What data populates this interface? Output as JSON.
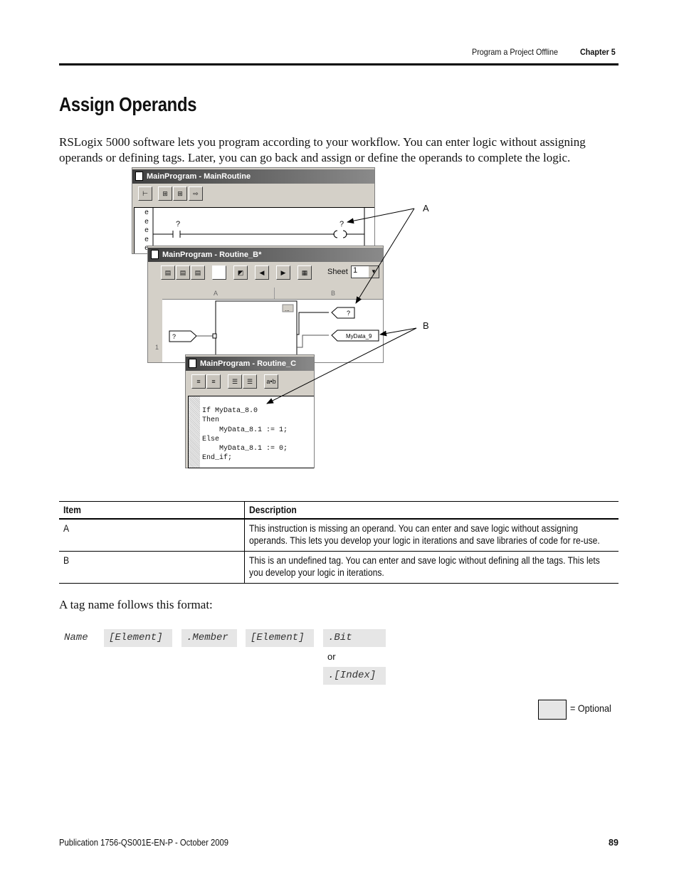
{
  "header": {
    "section": "Program a Project Offline",
    "chapter": "Chapter 5"
  },
  "title": "Assign Operands",
  "intro": "RSLogix 5000 software lets you program according to your workflow. You can enter logic without assigning operands or defining tags. Later, you can go back and assign or define the operands to complete the logic.",
  "figure": {
    "window1": {
      "title": "MainProgram - MainRoutine",
      "rung_markers": [
        "e",
        "e",
        "e",
        "e",
        "e"
      ],
      "contact_operand": "?",
      "coil_operand": "?"
    },
    "window2": {
      "title": "MainProgram - Routine_B*",
      "sheet_label": "Sheet",
      "sheet_value": "1",
      "columns": [
        "A",
        "B"
      ],
      "row": "1",
      "input_ref": "?",
      "output_ref1": "?",
      "output_ref2": "MyData_9",
      "block_button": "..."
    },
    "window3": {
      "title": "MainProgram - Routine_C",
      "format_button": "a•b",
      "code": [
        "If MyData_8.0",
        "Then",
        "    MyData_8.1 := 1;",
        "Else",
        "    MyData_8.1 := 0;",
        "End_if;"
      ]
    },
    "callouts": [
      "A",
      "B"
    ]
  },
  "table": {
    "headers": [
      "Item",
      "Description"
    ],
    "rows": [
      {
        "item": "A",
        "description": "This instruction is missing an operand. You can enter and save logic without assigning operands. This lets you develop your logic in iterations and save libraries of code for re-use."
      },
      {
        "item": "B",
        "description": "This is an undefined tag. You can enter and save logic without defining all the tags. This lets you develop your logic in iterations."
      }
    ]
  },
  "format_intro": "A tag name follows this format:",
  "format": {
    "name": "Name",
    "element1": "[Element]",
    "member": ".Member",
    "element2": "[Element]",
    "bit": ".Bit",
    "or": "or",
    "index": ".[Index]"
  },
  "legend": {
    "optional": "= Optional",
    "optional_color": "#e6e6e6"
  },
  "footer": {
    "publication": "Publication 1756-QS001E-EN-P - October 2009",
    "page": "89"
  }
}
